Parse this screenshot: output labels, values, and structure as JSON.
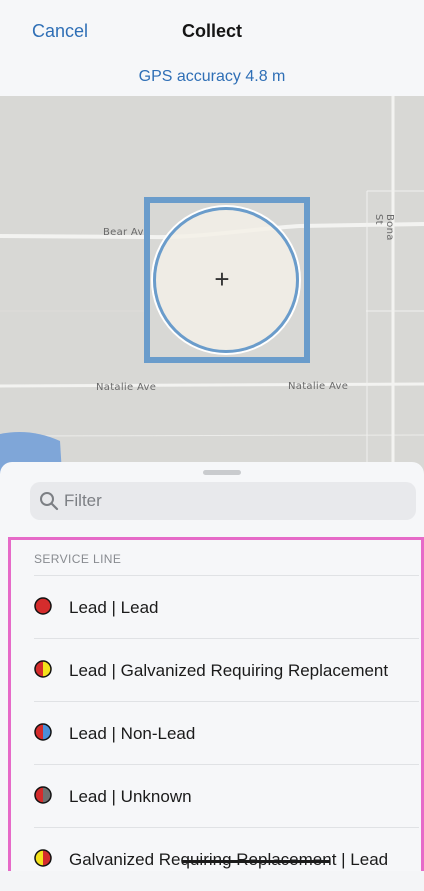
{
  "nav": {
    "cancel_label": "Cancel",
    "title": "Collect"
  },
  "gps": {
    "accuracy_text": "GPS accuracy 4.8 m"
  },
  "map": {
    "streets": {
      "bear": "Bear Av",
      "natalie_left": "Natalie Ave",
      "natalie_right": "Natalie Ave",
      "bona": "Bona St"
    },
    "crosshair": "+"
  },
  "sheet": {
    "filter_placeholder": "Filter",
    "section_header": "SERVICE LINE",
    "items": [
      {
        "label": "Lead | Lead",
        "colors": [
          "#d42c2c",
          "#d42c2c"
        ]
      },
      {
        "label": "Lead | Galvanized Requiring Replacement",
        "colors": [
          "#d42c2c",
          "#f4e21c"
        ]
      },
      {
        "label": "Lead | Non-Lead",
        "colors": [
          "#d42c2c",
          "#4a90d9"
        ]
      },
      {
        "label": "Lead | Unknown",
        "colors": [
          "#d42c2c",
          "#707070"
        ]
      },
      {
        "label": "Galvanized Requiring Replacement | Lead",
        "colors": [
          "#f4e21c",
          "#d42c2c"
        ]
      }
    ]
  },
  "colors": {
    "accent": "#2f6fb6",
    "highlight_border": "#e66ac8",
    "target": "#6a9ccb"
  }
}
